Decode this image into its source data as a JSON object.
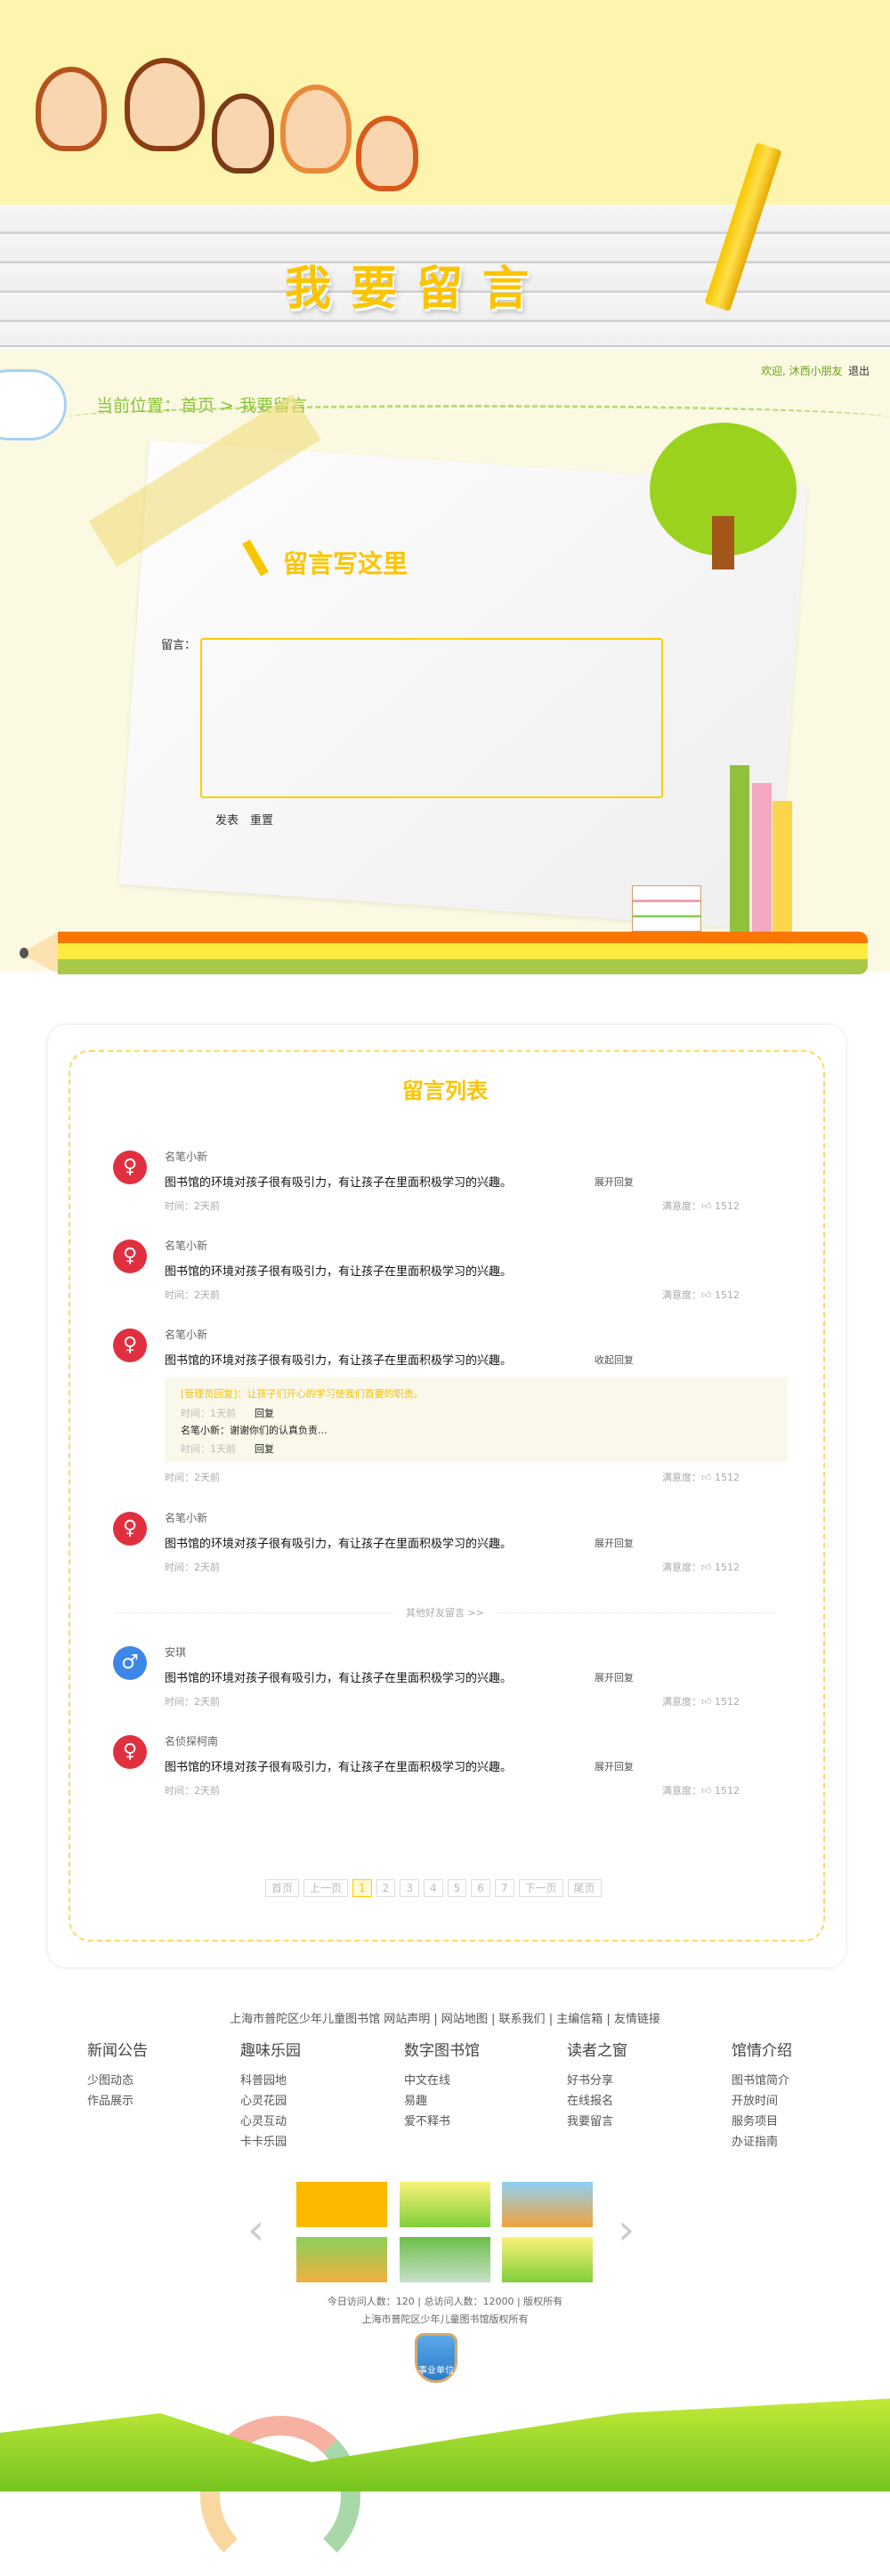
{
  "banner": {
    "title": "我要留言"
  },
  "user_bar": {
    "welcome": "欢迎, 沐西小朋友",
    "logout": "退出"
  },
  "breadcrumb": {
    "text": "当前位置：首页 > 我要留言"
  },
  "form": {
    "title": "留言写这里",
    "label": "留言：",
    "value": "",
    "submit": "发表",
    "reset": "重置",
    "accent": "#ffcc00"
  },
  "list": {
    "title": "留言列表",
    "comments": [
      {
        "name": "名笔小新",
        "gender": "female",
        "text": "图书馆的环境对孩子很有吸引力，有让孩子在里面积极学习的兴趣。",
        "toggle": "展开回复",
        "time": "时间：2天前",
        "sat_label": "满意度：",
        "likes": "1512"
      },
      {
        "name": "名笔小新",
        "gender": "female",
        "text": "图书馆的环境对孩子很有吸引力，有让孩子在里面积极学习的兴趣。",
        "toggle": "",
        "time": "时间：2天前",
        "sat_label": "满意度：",
        "likes": "1512"
      },
      {
        "name": "名笔小新",
        "gender": "female",
        "text": "图书馆的环境对孩子很有吸引力，有让孩子在里面积极学习的兴趣。",
        "toggle": "收起回复",
        "time": "时间：2天前",
        "sat_label": "满意度：",
        "likes": "1512"
      },
      {
        "name": "名笔小新",
        "gender": "female",
        "text": "图书馆的环境对孩子很有吸引力，有让孩子在里面积极学习的兴趣。",
        "toggle": "展开回复",
        "time": "时间：2天前",
        "sat_label": "满意度：",
        "likes": "1512"
      },
      {
        "name": "安琪",
        "gender": "male",
        "text": "图书馆的环境对孩子很有吸引力，有让孩子在里面积极学习的兴趣。",
        "toggle": "展开回复",
        "time": "时间：2天前",
        "sat_label": "满意度：",
        "likes": "1512"
      },
      {
        "name": "名侦探柯南",
        "gender": "female",
        "text": "图书馆的环境对孩子很有吸引力，有让孩子在里面积极学习的兴趣。",
        "toggle": "展开回复",
        "time": "时间：2天前",
        "sat_label": "满意度：",
        "likes": "1512"
      }
    ],
    "reply": {
      "admin": "[管理员回复]：让孩子们开心的学习使我们首要的职责。",
      "admin_time": "时间：1天前",
      "reply_label": "回复",
      "user": "名笔小新：谢谢你们的认真负责...",
      "user_time": "时间：1天前"
    },
    "others": "其他好友留言 >>",
    "pagination": [
      "首页",
      "上一页",
      "1",
      "2",
      "3",
      "4",
      "5",
      "6",
      "7",
      "下一页",
      "尾页"
    ],
    "current_page": "1",
    "colors": {
      "female": "#e0303f",
      "male": "#3d87e8",
      "title": "#fcc400"
    }
  },
  "footer": {
    "links": "上海市普陀区少年儿童图书馆  网站声明 | 网站地图 | 联系我们 | 主编信箱 | 友情链接",
    "columns": [
      {
        "title": "新闻公告",
        "items": [
          "少图动态",
          "作品展示"
        ]
      },
      {
        "title": "趣味乐园",
        "items": [
          "科普园地",
          "心灵花园",
          "心灵互动",
          "卡卡乐园"
        ]
      },
      {
        "title": "数字图书馆",
        "items": [
          "中文在线",
          "易趣",
          "爱不释书"
        ]
      },
      {
        "title": "读者之窗",
        "items": [
          "好书分享",
          "在线报名",
          "我要留言"
        ]
      },
      {
        "title": "馆情介绍",
        "items": [
          "图书馆简介",
          "开放时间",
          "服务项目",
          "办证指南"
        ]
      }
    ],
    "stats": "今日访问人数：120 | 总访问人数：12000 | 版权所有",
    "copyright": "上海市普陀区少年儿童图书馆版权所有",
    "badge": "事业单位"
  }
}
